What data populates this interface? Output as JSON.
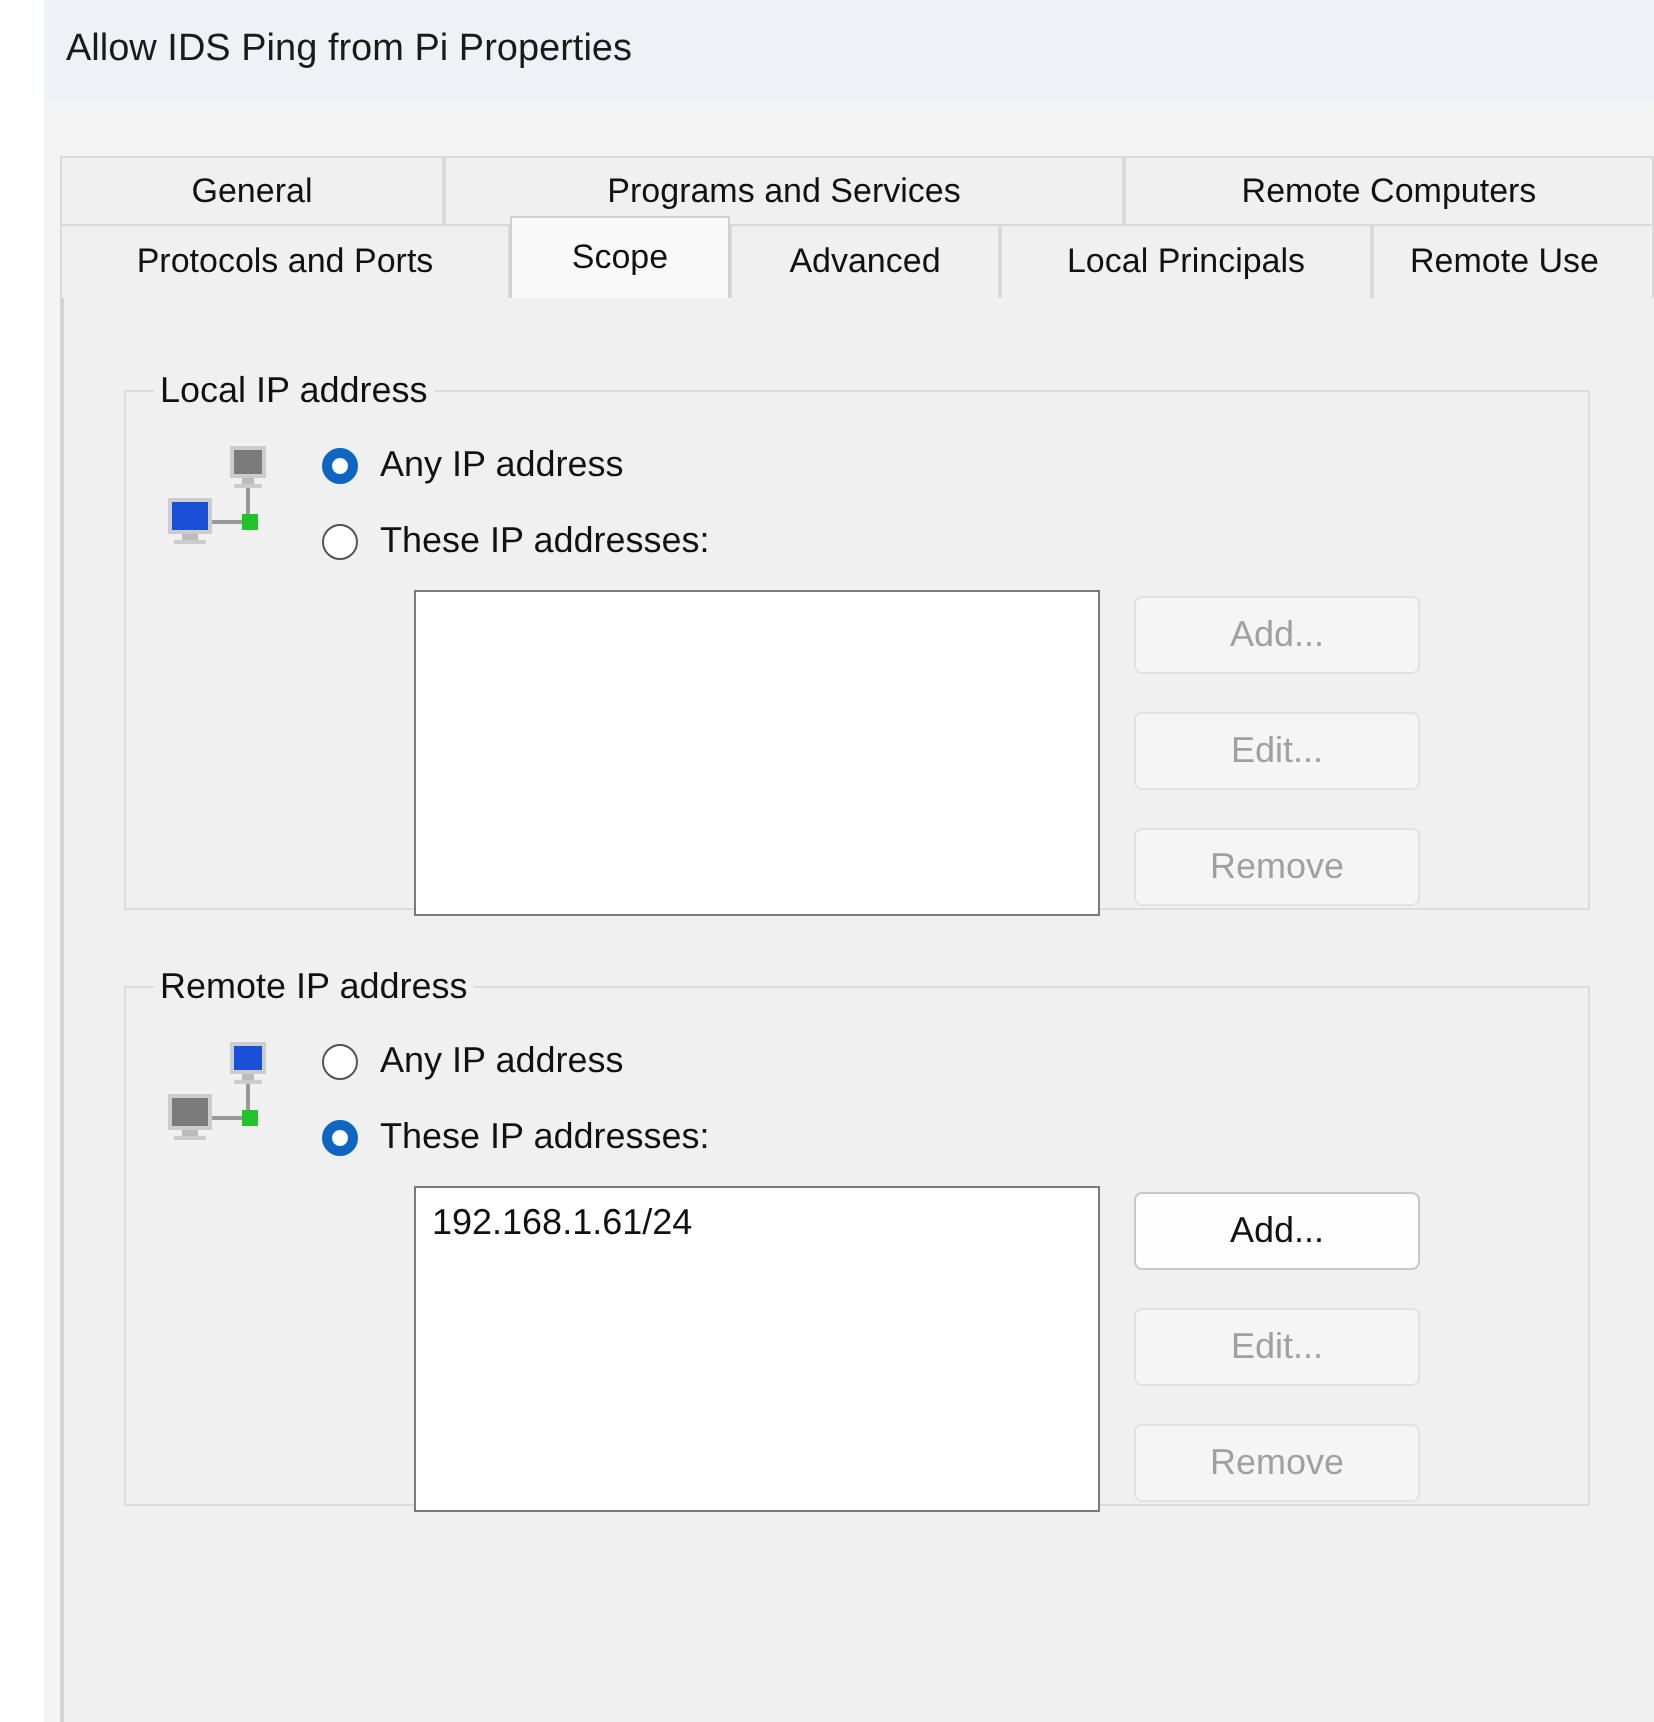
{
  "window": {
    "title": "Allow IDS Ping from Pi Properties"
  },
  "tab_rows": [
    [
      {
        "label": "General",
        "selected": false
      },
      {
        "label": "Programs and Services",
        "selected": false
      },
      {
        "label": "Remote Computers",
        "selected": false
      }
    ],
    [
      {
        "label": "Protocols and Ports",
        "selected": false
      },
      {
        "label": "Scope",
        "selected": true
      },
      {
        "label": "Advanced",
        "selected": false
      },
      {
        "label": "Local Principals",
        "selected": false
      },
      {
        "label": "Remote Use",
        "selected": false
      }
    ]
  ],
  "groups": [
    {
      "legend": "Local IP address",
      "kind": "local",
      "options": [
        {
          "label": "Any IP address",
          "selected": true
        },
        {
          "label": "These IP addresses:",
          "selected": false
        }
      ],
      "buttons": [
        {
          "label": "Add...",
          "disabled": true
        },
        {
          "label": "Edit...",
          "disabled": true
        },
        {
          "label": "Remove",
          "disabled": true
        }
      ]
    },
    {
      "legend": "Remote IP address",
      "kind": "remote",
      "options": [
        {
          "label": "Any IP address",
          "selected": false
        },
        {
          "label": "These IP addresses:",
          "selected": true
        }
      ],
      "addresses": [
        "192.168.1.61/24"
      ],
      "buttons": [
        {
          "label": "Add...",
          "disabled": false
        },
        {
          "label": "Edit...",
          "disabled": true
        },
        {
          "label": "Remove",
          "disabled": true
        }
      ]
    }
  ]
}
